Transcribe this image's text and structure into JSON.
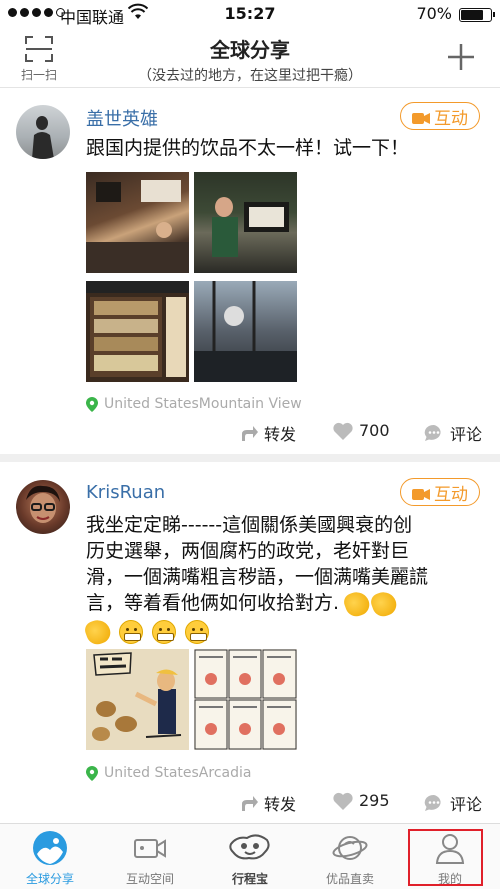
{
  "status_bar": {
    "carrier": "中国联通",
    "time": "15:27",
    "battery": "70%"
  },
  "nav": {
    "scan_label": "扫一扫",
    "title": "全球分享",
    "subtitle": "（没去过的地方，在这里过把干瘾）"
  },
  "posts": [
    {
      "username": "盖世英雄",
      "tag": "互动",
      "text": "跟国内提供的饮品不太一样！试一下！",
      "location": "United StatesMountain View",
      "repost_label": "转发",
      "likes": "700",
      "comment_label": "评论"
    },
    {
      "username": "KrisRuan",
      "tag": "互动",
      "text_lines": [
        "我坐定定睇------這個關係美國興衰的创",
        "历史選舉，两個腐朽的政党，老奸對巨",
        "滑，一個满嘴粗言秽語，一個满嘴美麗謊",
        "言，等着看他俩如何收拾對方."
      ],
      "location": "United StatesArcadia",
      "repost_label": "转发",
      "likes": "295",
      "comment_label": "评论"
    }
  ],
  "tabs": [
    {
      "label": "全球分享",
      "icon": "globe-icon",
      "active": true
    },
    {
      "label": "互动空间",
      "icon": "video-camera-icon",
      "active": false
    },
    {
      "label": "行程宝",
      "icon": "mascot-icon",
      "active": false
    },
    {
      "label": "优品直卖",
      "icon": "planet-icon",
      "active": false
    },
    {
      "label": "我的",
      "icon": "person-icon",
      "active": false
    }
  ],
  "colors": {
    "accent_blue": "#2a9be0",
    "tag_orange": "#f39a2b",
    "username_blue": "#3a6fa8",
    "highlight_red": "#e0202a"
  }
}
